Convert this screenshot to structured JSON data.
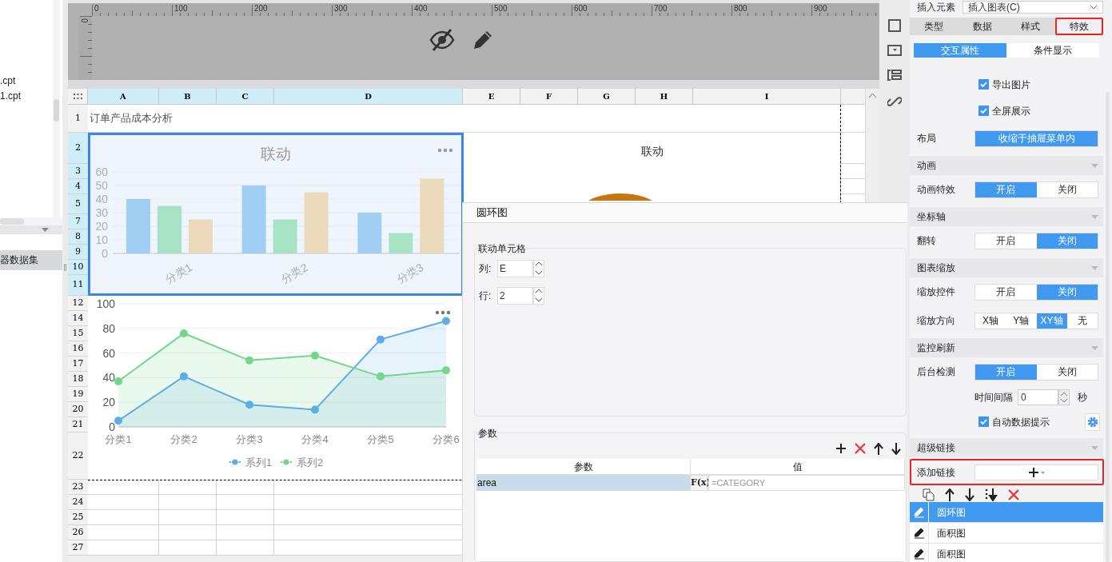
{
  "left_panel": {
    "files": [
      {
        "name": ".cpt"
      },
      {
        "name": "1.cpt"
      }
    ],
    "dataset_tab": "器数据集"
  },
  "ruler": {
    "labels": [
      "0",
      "100",
      "200",
      "300",
      "400",
      "500",
      "600",
      "700",
      "800",
      "900"
    ],
    "vertical_label": "0"
  },
  "sheet": {
    "columns": [
      {
        "label": "A",
        "selected": true
      },
      {
        "label": "B",
        "selected": true
      },
      {
        "label": "C",
        "selected": true
      },
      {
        "label": "D",
        "selected": true
      },
      {
        "label": "E",
        "selected": false
      },
      {
        "label": "F",
        "selected": false
      },
      {
        "label": "G",
        "selected": false
      },
      {
        "label": "H",
        "selected": false
      },
      {
        "label": "I",
        "selected": false
      }
    ],
    "rows": [
      {
        "label": "1",
        "selected": false
      },
      {
        "label": "2",
        "selected": true
      },
      {
        "label": "3",
        "selected": true
      },
      {
        "label": "4",
        "selected": true
      },
      {
        "label": "5",
        "selected": true
      },
      {
        "label": "7",
        "selected": true
      },
      {
        "label": "8",
        "selected": true
      },
      {
        "label": "9",
        "selected": true
      },
      {
        "label": "10",
        "selected": true
      },
      {
        "label": "11",
        "selected": true
      },
      {
        "label": "12",
        "selected": false
      },
      {
        "label": "14",
        "selected": false
      },
      {
        "label": "15",
        "selected": false
      },
      {
        "label": "16",
        "selected": false
      },
      {
        "label": "17",
        "selected": false
      },
      {
        "label": "18",
        "selected": false
      },
      {
        "label": "19",
        "selected": false
      },
      {
        "label": "20",
        "selected": false
      },
      {
        "label": "21",
        "selected": false
      },
      {
        "label": "22",
        "selected": false
      },
      {
        "label": "23",
        "selected": false
      },
      {
        "label": "24",
        "selected": false
      },
      {
        "label": "25",
        "selected": false
      },
      {
        "label": "26",
        "selected": false
      },
      {
        "label": "27",
        "selected": false
      }
    ],
    "title_cell": "订单产品成本分析"
  },
  "bar_chart": {
    "title": "联动",
    "selected": true,
    "chart_data": {
      "type": "bar",
      "categories": [
        "分类1",
        "分类2",
        "分类3"
      ],
      "yticks": [
        0,
        10,
        20,
        30,
        40,
        50,
        60
      ],
      "ylim": [
        0,
        60
      ],
      "series": [
        {
          "color": "#a0cff3",
          "values": [
            40,
            50,
            30
          ]
        },
        {
          "color": "#a9e3c5",
          "values": [
            35,
            25,
            15
          ]
        },
        {
          "color": "#eadabb",
          "values": [
            25,
            45,
            55
          ]
        }
      ]
    }
  },
  "line_chart": {
    "chart_data": {
      "type": "area",
      "grid": true,
      "legend": "bottom",
      "categories": [
        "分类1",
        "分类2",
        "分类3",
        "分类4",
        "分类5",
        "分类6"
      ],
      "yticks": [
        0,
        20,
        40,
        60,
        80,
        100
      ],
      "ylim": [
        0,
        100
      ],
      "series": [
        {
          "name": "系列1",
          "color": "#5eade6",
          "values": [
            5,
            41,
            18,
            14,
            71,
            86
          ]
        },
        {
          "name": "系列2",
          "color": "#72d68b",
          "values": [
            37,
            76,
            54,
            58,
            41,
            46
          ]
        }
      ]
    }
  },
  "donut_chart": {
    "title": "联动"
  },
  "dialog": {
    "title": "圆环图",
    "linkage": {
      "title": "联动单元格",
      "fields": [
        {
          "label": "列:",
          "value": "E"
        },
        {
          "label": "行:",
          "value": "2"
        }
      ]
    },
    "params": {
      "title": "参数",
      "columns": [
        "参数",
        "值"
      ],
      "rows": [
        {
          "param": "area",
          "formula": "F(x)",
          "placeholder": "=CATEGORY",
          "selected": true
        }
      ]
    }
  },
  "right_panel": {
    "insert": {
      "label": "插入元素",
      "value": "插入图表(C)"
    },
    "tabs": [
      {
        "label": "类型",
        "selected": false,
        "highlighted": false
      },
      {
        "label": "数据",
        "selected": false,
        "highlighted": false
      },
      {
        "label": "样式",
        "selected": false,
        "highlighted": false
      },
      {
        "label": "特效",
        "selected": true,
        "highlighted": true
      }
    ],
    "subtabs": [
      {
        "label": "交互属性",
        "selected": true
      },
      {
        "label": "条件显示",
        "selected": false
      }
    ],
    "items": [
      {
        "kind": "checkbox",
        "label": "导出图片",
        "checked": true
      },
      {
        "kind": "checkbox",
        "label": "全屏展示",
        "checked": true
      },
      {
        "kind": "toggle",
        "label": "布局",
        "options": [
          {
            "label": "收缩于抽屉菜单内",
            "selected": true
          }
        ]
      },
      {
        "kind": "section",
        "label": "动画"
      },
      {
        "kind": "toggle",
        "label": "动画特效",
        "options": [
          {
            "label": "开启",
            "selected": true
          },
          {
            "label": "关闭",
            "selected": false
          }
        ]
      },
      {
        "kind": "section",
        "label": "坐标轴"
      },
      {
        "kind": "toggle",
        "label": "翻转",
        "options": [
          {
            "label": "开启",
            "selected": false
          },
          {
            "label": "关闭",
            "selected": true
          }
        ]
      },
      {
        "kind": "section",
        "label": "图表缩放"
      },
      {
        "kind": "toggle",
        "label": "缩放控件",
        "options": [
          {
            "label": "开启",
            "selected": false
          },
          {
            "label": "关闭",
            "selected": true
          }
        ]
      },
      {
        "kind": "toggle",
        "label": "缩放方向",
        "options": [
          {
            "label": "X轴",
            "selected": false
          },
          {
            "label": "Y轴",
            "selected": false
          },
          {
            "label": "XY轴",
            "selected": true
          },
          {
            "label": "无",
            "selected": false
          }
        ]
      },
      {
        "kind": "section",
        "label": "监控刷新"
      },
      {
        "kind": "toggle",
        "label": "后台检测",
        "options": [
          {
            "label": "开启",
            "selected": true
          },
          {
            "label": "关闭",
            "selected": false
          }
        ]
      },
      {
        "kind": "spinner",
        "label": "时间间隔",
        "value": "0",
        "unit": "秒"
      },
      {
        "kind": "setting",
        "label": "自动数据提示",
        "checked": true
      },
      {
        "kind": "section",
        "label": "超级链接"
      },
      {
        "kind": "add",
        "label": "添加链接",
        "highlighted": true
      }
    ],
    "links": [
      {
        "label": "圆环图",
        "selected": true
      },
      {
        "label": "面积图",
        "selected": false
      },
      {
        "label": "面积图",
        "selected": false
      }
    ]
  }
}
